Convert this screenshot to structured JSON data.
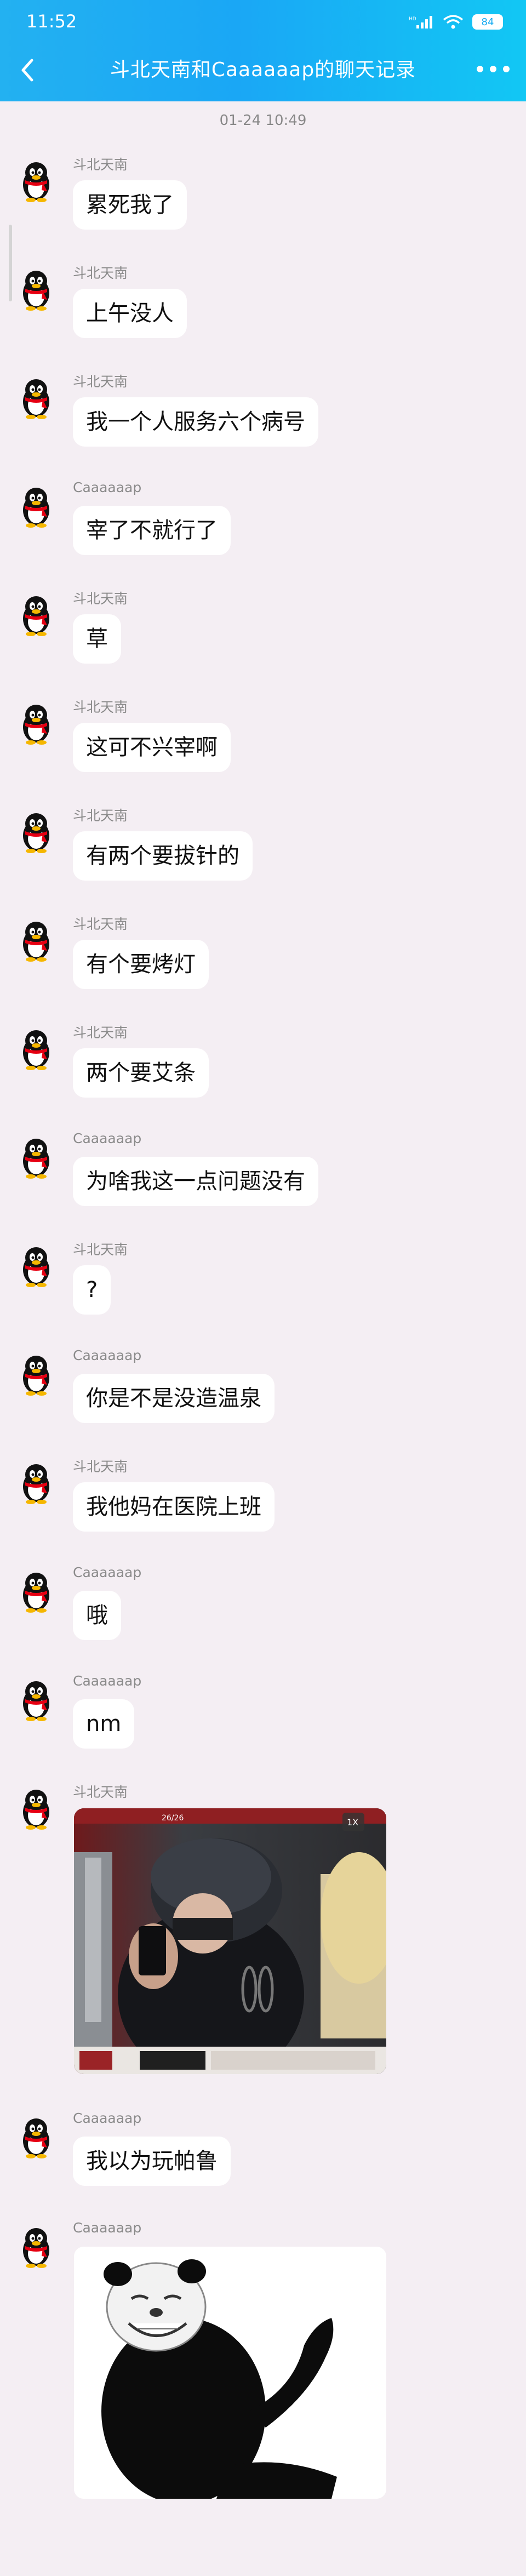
{
  "status_bar": {
    "time": "11:52",
    "battery": "84"
  },
  "header": {
    "title": "斗北天南和Caaaaaap的聊天记录"
  },
  "chat": {
    "timestamp": "01-24 10:49",
    "messages": [
      {
        "sender": "斗北天南",
        "text": "累死我了"
      },
      {
        "sender": "斗北天南",
        "text": "上午没人"
      },
      {
        "sender": "斗北天南",
        "text": "我一个人服务六个病号"
      },
      {
        "sender": "Caaaaaap",
        "text": "宰了不就行了"
      },
      {
        "sender": "斗北天南",
        "text": "草"
      },
      {
        "sender": "斗北天南",
        "text": "这可不兴宰啊"
      },
      {
        "sender": "斗北天南",
        "text": "有两个要拔针的"
      },
      {
        "sender": "斗北天南",
        "text": "有个要烤灯"
      },
      {
        "sender": "斗北天南",
        "text": "两个要艾条"
      },
      {
        "sender": "Caaaaaap",
        "text": "为啥我这一点问题没有"
      },
      {
        "sender": "斗北天南",
        "text": "?"
      },
      {
        "sender": "Caaaaaap",
        "text": "你是不是没造温泉"
      },
      {
        "sender": "斗北天南",
        "text": "我他妈在医院上班"
      },
      {
        "sender": "Caaaaaap",
        "text": "哦"
      },
      {
        "sender": "Caaaaaap",
        "text": "nm"
      },
      {
        "sender": "斗北天南",
        "image": "photo-of-person-in-helmet-holding-phone",
        "overlay_page": "26/26",
        "overlay_speed": "1X"
      },
      {
        "sender": "Caaaaaap",
        "text": "我以为玩帕鲁"
      },
      {
        "sender": "Caaaaaap",
        "image": "panda-meme-sticker"
      }
    ]
  },
  "colors": {
    "header_gradient_start": "#23b1f1",
    "header_gradient_end": "#12c7f4",
    "background": "#f4eef3",
    "bubble": "#ffffff",
    "sender_text": "#8a8a8a"
  },
  "icons": {
    "back": "chevron-left-icon",
    "more": "more-dots-icon",
    "avatar": "penguin-avatar-icon"
  }
}
